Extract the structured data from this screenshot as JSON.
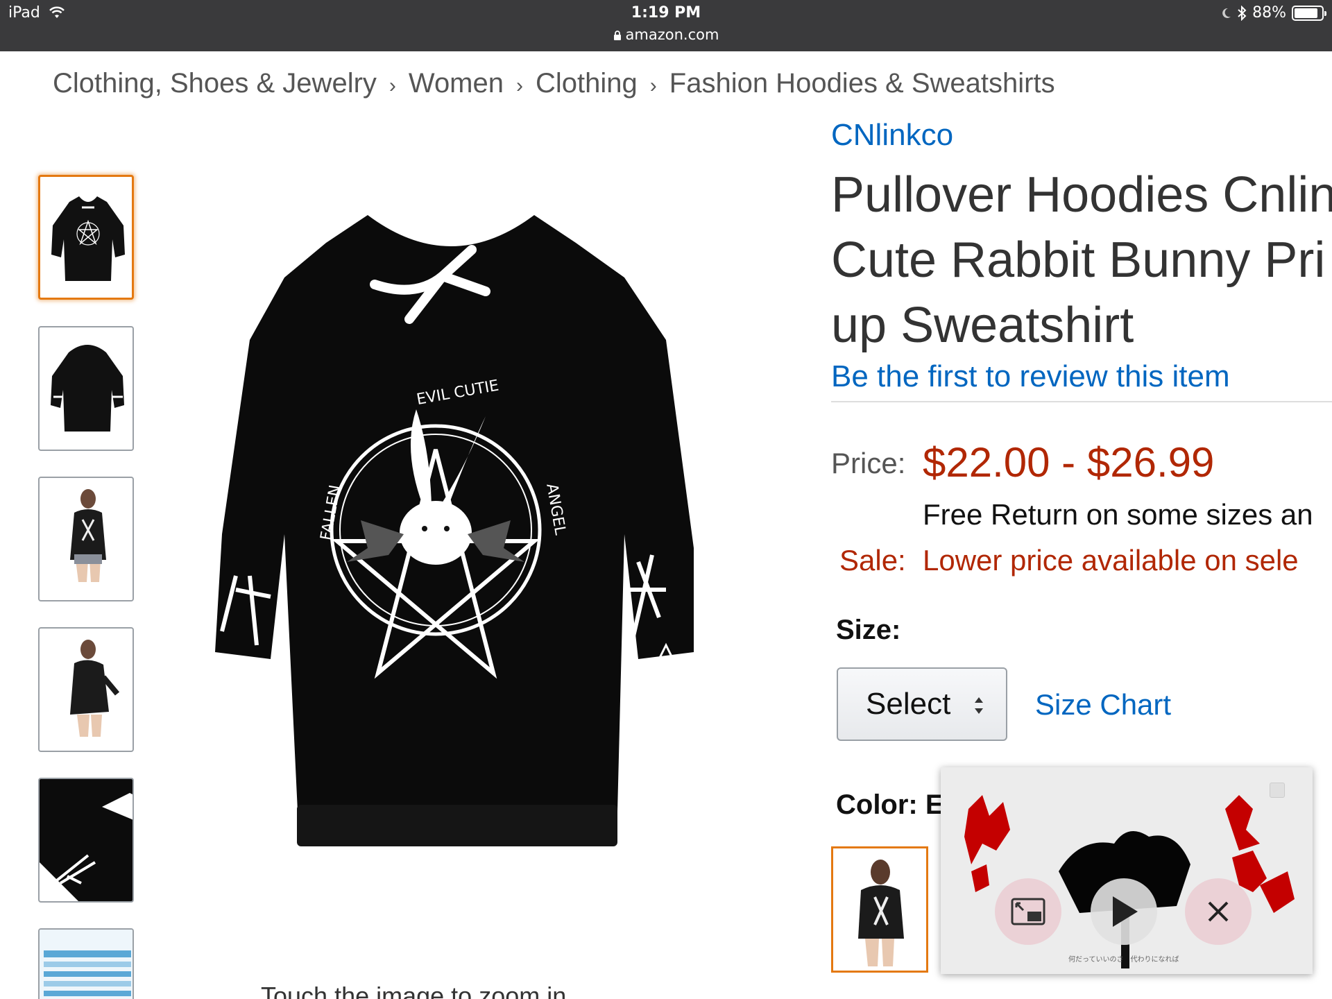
{
  "status_bar": {
    "device": "iPad",
    "time": "1:19 PM",
    "url": "amazon.com",
    "battery": "88%",
    "battery_level": 0.88
  },
  "breadcrumb": [
    "Clothing, Shoes & Jewelry",
    "Women",
    "Clothing",
    "Fashion Hoodies & Sweatshirts"
  ],
  "product": {
    "brand": "CNlinkco",
    "title_lines": [
      "Pullover Hoodies Cnlin",
      "Cute Rabbit Bunny Pri",
      "up Sweatshirt"
    ],
    "review_link": "Be the first to review this item",
    "price_label": "Price:",
    "price": "$22.00 - $26.99",
    "free_return": "Free Return on some sizes an",
    "sale_label": "Sale:",
    "sale_text": "Lower price available on sele",
    "size_label": "Size:",
    "size_select": "Select",
    "size_chart": "Size Chart",
    "color_label": "Color: E"
  },
  "gallery": {
    "zoom_hint": "Touch the image to zoom in",
    "thumbnail_count": 6,
    "selected_index": 0
  },
  "pip_video": {
    "subtitle": "何だっていいのさ　代わりになれば"
  },
  "colors": {
    "link": "#0066c0",
    "price": "#b12704",
    "selected_border": "#e47911",
    "status_bar": "#3a3a3c"
  }
}
